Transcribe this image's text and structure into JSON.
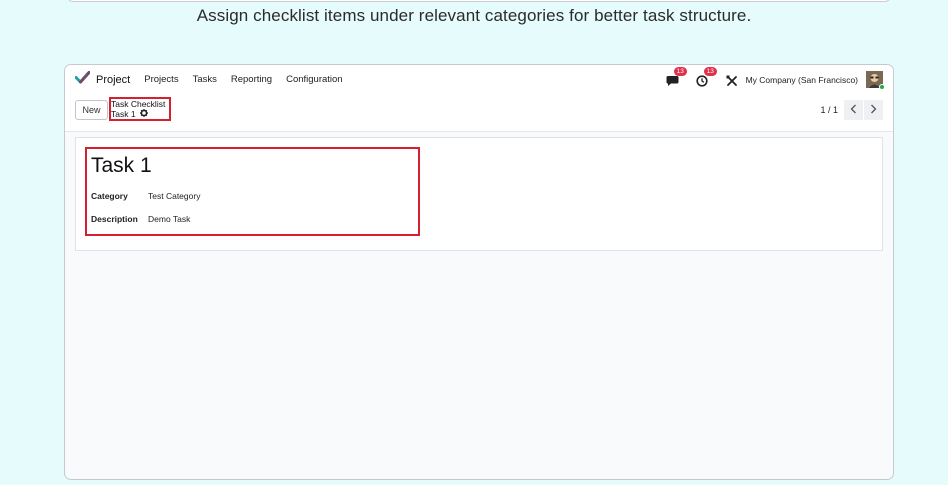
{
  "caption": "Assign checklist items under relevant categories for better task structure.",
  "navbar": {
    "app_name": "Project",
    "menu": [
      "Projects",
      "Tasks",
      "Reporting",
      "Configuration"
    ],
    "messages_badge": "13",
    "activities_badge": "13",
    "company": "My Company (San Francisco)"
  },
  "control_panel": {
    "new_label": "New",
    "breadcrumb_parent": "Task Checklist",
    "breadcrumb_current": "Task 1",
    "pager_value": "1 / 1"
  },
  "record": {
    "title": "Task 1",
    "category_label": "Category",
    "category_value": "Test Category",
    "description_label": "Description",
    "description_value": "Demo Task"
  },
  "colors": {
    "background": "#e6fbfc",
    "highlight": "#d5212f",
    "badge": "#e0314a",
    "brand_check_teal": "#1aa6a6",
    "brand_check_purple": "#714b67"
  },
  "icons": [
    "checkmark-logo-icon",
    "chat-icon",
    "clock-icon",
    "tools-icon",
    "gear-icon",
    "chevron-left-icon",
    "chevron-right-icon"
  ]
}
